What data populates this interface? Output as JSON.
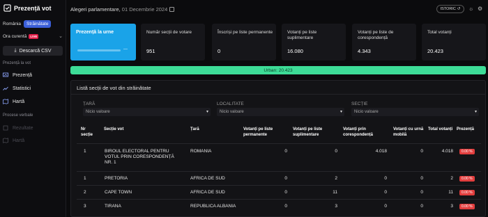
{
  "sidebar": {
    "app_title": "Prezență vot",
    "scope_label": "România",
    "scope_badge": "Străinătate",
    "time_label": "Ora curentă",
    "live_badge": "LIVE",
    "csv_button": "Descarcă CSV",
    "section_turnout": "Prezență la vot",
    "nav": [
      {
        "label": "Prezență",
        "icon": "monitor-icon"
      },
      {
        "label": "Statistici",
        "icon": "trend-icon"
      },
      {
        "label": "Hartă",
        "icon": "map-icon"
      }
    ],
    "section_verbal": "Procese verbale",
    "nav_disabled": [
      {
        "label": "Rezultate",
        "icon": "results-icon"
      },
      {
        "label": "Hartă",
        "icon": "map-icon"
      }
    ]
  },
  "header": {
    "election": "Alegeri parlamentare",
    "date": "01 Decembrie 2024",
    "istoric": "ISTORIC"
  },
  "cards": [
    {
      "label": "Prezență la urne",
      "value": "---",
      "progress": 0
    },
    {
      "label": "Număr secții de votare",
      "value": "951"
    },
    {
      "label": "Înscriși pe liste permanente",
      "value": "0"
    },
    {
      "label": "Votanți pe liste suplimentare",
      "value": "16.080"
    },
    {
      "label": "Votanți pe liste de corespondență",
      "value": "4.343"
    },
    {
      "label": "Total votanți",
      "value": "20.423"
    }
  ],
  "urban": "Urban: 20.423",
  "panel": {
    "title": "Listă secții de vot din străinătate",
    "filters": [
      {
        "label": "ȚARĂ",
        "placeholder": "Nicio valoare"
      },
      {
        "label": "LOCALITATE",
        "placeholder": "Nicio valoare"
      },
      {
        "label": "SECȚIE",
        "placeholder": "Nicio valoare"
      }
    ],
    "columns": [
      "Nr secție",
      "Secție vot",
      "Țară",
      "Votanți pe liste permanente",
      "Votanți pe liste suplimentare",
      "Votanți prin corespondență",
      "Votanți cu urnă mobilă",
      "Total votanți",
      "Prezență"
    ],
    "rows": [
      {
        "nr": "1",
        "sectie": "BIROUL ELECTORAL PENTRU VOTUL PRIN CORESPONDENȚĂ NR. 1",
        "tara": "ROMANIA",
        "perm": "0",
        "supl": "0",
        "coresp": "4.018",
        "mobila": "0",
        "total": "4.018",
        "prezenta": "0.00 %"
      },
      {
        "nr": "1",
        "sectie": "PRETORIA",
        "tara": "AFRICA DE SUD",
        "perm": "0",
        "supl": "2",
        "coresp": "0",
        "mobila": "0",
        "total": "2",
        "prezenta": "0.00 %"
      },
      {
        "nr": "2",
        "sectie": "CAPE TOWN",
        "tara": "AFRICA DE SUD",
        "perm": "0",
        "supl": "11",
        "coresp": "0",
        "mobila": "0",
        "total": "11",
        "prezenta": "0.00 %"
      },
      {
        "nr": "3",
        "sectie": "TIRANA",
        "tara": "REPUBLICA ALBANIA",
        "perm": "0",
        "supl": "3",
        "coresp": "0",
        "mobila": "0",
        "total": "3",
        "prezenta": "0.00 %"
      }
    ]
  }
}
